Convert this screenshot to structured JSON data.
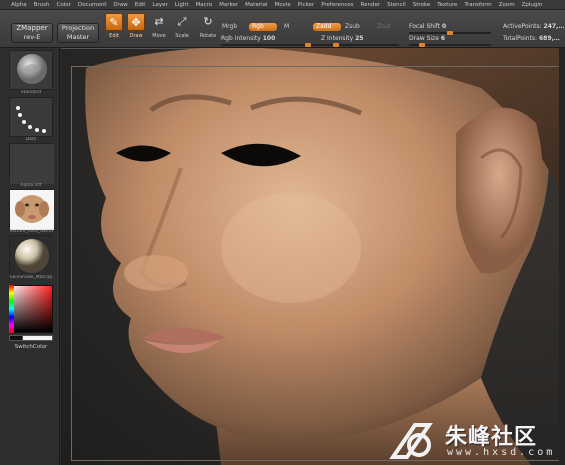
{
  "menu": [
    "Alpha",
    "Brush",
    "Color",
    "Document",
    "Draw",
    "Edit",
    "Layer",
    "Light",
    "Macro",
    "Marker",
    "Material",
    "Movie",
    "Picker",
    "Preferences",
    "Render",
    "Stencil",
    "Stroke",
    "Texture",
    "Transform",
    "Zoom",
    "Zplugin"
  ],
  "shelf": {
    "zmapper": {
      "line1": "ZMapper",
      "line2": "rev-E"
    },
    "projection": {
      "line1": "Projection",
      "line2": "Master"
    },
    "tools": [
      {
        "label": "Edit",
        "icon": "edit-icon",
        "glyph": "✎",
        "active": true
      },
      {
        "label": "Draw",
        "icon": "draw-icon",
        "glyph": "✥",
        "active": true
      },
      {
        "label": "Move",
        "icon": "move-icon",
        "glyph": "⇄",
        "active": false
      },
      {
        "label": "Scale",
        "icon": "scale-icon",
        "glyph": "⤢",
        "active": false
      },
      {
        "label": "Rotate",
        "icon": "rotate-icon",
        "glyph": "↻",
        "active": false
      }
    ],
    "mrgb": "Mrgb",
    "rgb": "Rgb",
    "m": "M",
    "rgb_intensity": {
      "label": "Rgb Intensity",
      "value": "100"
    },
    "zadd": "Zadd",
    "zsub": "Zsub",
    "zcut": "Zcut",
    "z_intensity": {
      "label": "Z Intensity",
      "value": "25"
    },
    "focal_shift": {
      "label": "Focal Shift",
      "value": "0"
    },
    "draw_size": {
      "label": "Draw Size",
      "value": "6"
    },
    "active_points": {
      "label": "ActivePoints:",
      "value": "247,…"
    },
    "total_points": {
      "label": "TotalPoints:",
      "value": "689,…"
    }
  },
  "tray": {
    "items": [
      {
        "label": "Standard",
        "icon": "standard-brush-icon"
      },
      {
        "label": "Dots",
        "icon": "dots-stroke-icon"
      },
      {
        "label": "Alpha Off",
        "icon": "alpha-icon"
      },
      {
        "label": "Texture_Face_Nechan",
        "icon": "texture-icon"
      },
      {
        "label": "SkinShade_Matcap",
        "icon": "material-sphere-icon"
      }
    ],
    "switch_color": "SwitchColor"
  },
  "watermark": {
    "title": "朱峰社区",
    "url": "www.hxsd.com"
  },
  "colors": {
    "accent": "#e0842a",
    "panel": "#2e2e2e",
    "shelf": "#3f3f3f"
  }
}
